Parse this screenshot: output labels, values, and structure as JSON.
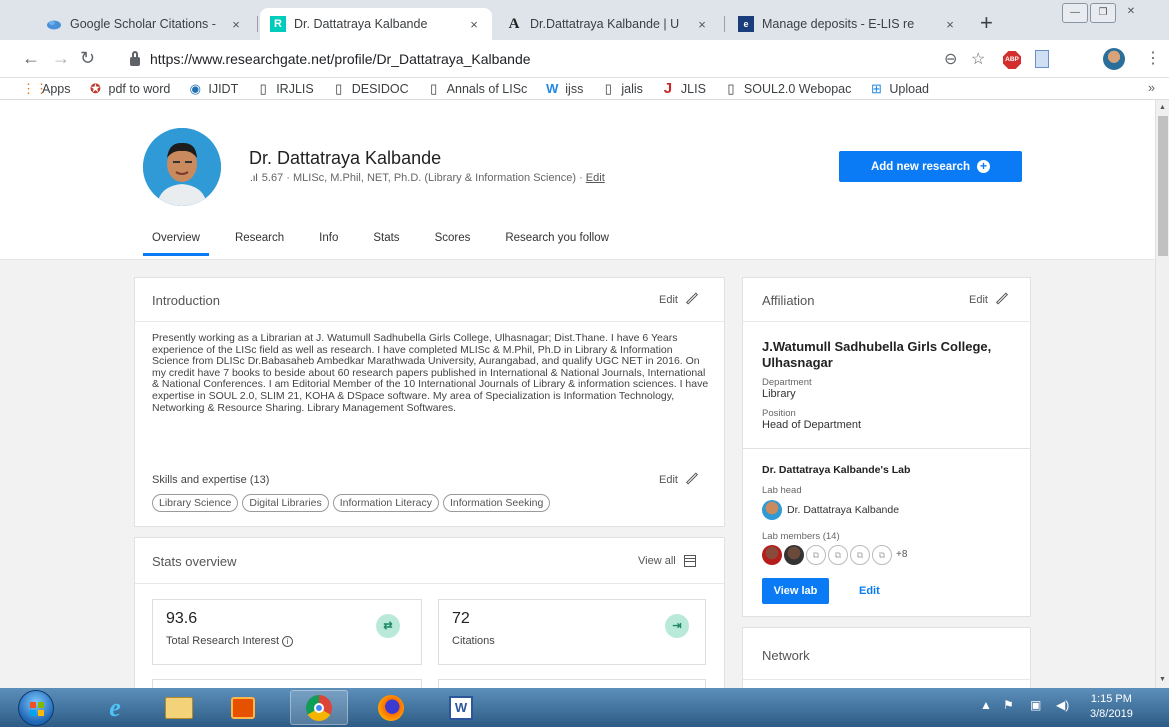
{
  "browser": {
    "tabs": [
      {
        "title": "Google Scholar Citations - ",
        "favicon": "google-scholar-icon",
        "active": false
      },
      {
        "title": "Dr. Dattatraya Kalbande",
        "favicon": "researchgate-icon",
        "active": true
      },
      {
        "title": "Dr.Dattatraya Kalbande | U",
        "favicon": "academia-icon",
        "active": false
      },
      {
        "title": "Manage deposits - E-LIS re",
        "favicon": "elis-icon",
        "active": false
      }
    ],
    "favicon_text": {
      "researchgate": "R",
      "academia": "A",
      "elis": "e"
    },
    "close_glyph": "×",
    "newtab_glyph": "+",
    "url": "https://www.researchgate.net/profile/Dr_Dattatraya_Kalbande",
    "bookmarks": [
      {
        "label": "Apps",
        "icon": "apps-grid-icon"
      },
      {
        "label": "pdf to word",
        "icon": "pdf-icon"
      },
      {
        "label": "IJIDT",
        "icon": "globe-icon"
      },
      {
        "label": "IRJLIS",
        "icon": "page-icon"
      },
      {
        "label": "DESIDOC",
        "icon": "page-icon"
      },
      {
        "label": "Annals of LISc",
        "icon": "page-icon"
      },
      {
        "label": "ijss",
        "icon": "wix-icon"
      },
      {
        "label": "jalis",
        "icon": "page-icon"
      },
      {
        "label": "JLIS",
        "icon": "j-icon"
      },
      {
        "label": "SOUL2.0 Webopac",
        "icon": "page-icon"
      },
      {
        "label": "Upload",
        "icon": "upload-icon"
      }
    ],
    "bookmarks_more": "»"
  },
  "profile": {
    "name": "Dr. Dattatraya Kalbande",
    "rg_score": "5.67",
    "degrees": " · MLISc, M.Phil, NET, Ph.D. (Library & Information Science) · ",
    "edit_link": "Edit",
    "add_button": "Add new research",
    "tabs": [
      "Overview",
      "Research",
      "Info",
      "Stats",
      "Scores",
      "Research you follow"
    ]
  },
  "introduction": {
    "title": "Introduction",
    "edit": "Edit",
    "text": "Presently working as a Librarian at J. Watumull Sadhubella Girls College, Ulhasnagar; Dist.Thane. I have 6 Years experience of the LISc field as well as research. I have completed MLISc & M.Phil, Ph.D in Library & Information Science from DLISc Dr.Babasaheb Ambedkar Marathwada University, Aurangabad, and qualify UGC NET in 2016. On my credit have 7 books to beside about 60 research papers published in International & National Journals, International & National Conferences. I am Editorial Member of the 10 International Journals of Library & information sciences. I have expertise in SOUL 2.0, SLIM 21, KOHA & DSpace software. My area of Specialization is Information Technology, Networking & Resource Sharing. Library Management Softwares.",
    "skills_title": "Skills and expertise (13)",
    "skills": [
      "Library Science",
      "Digital Libraries",
      "Information Literacy",
      "Information Seeking"
    ]
  },
  "stats": {
    "title": "Stats overview",
    "view_all": "View all",
    "items": [
      {
        "value": "93.6",
        "label": "Total Research Interest"
      },
      {
        "value": "72",
        "label": "Citations"
      }
    ]
  },
  "affiliation": {
    "title": "Affiliation",
    "edit": "Edit",
    "org": "J.Watumull Sadhubella Girls College, Ulhasnagar",
    "department_label": "Department",
    "department": "Library",
    "position_label": "Position",
    "position": "Head of Department",
    "lab_title": "Dr. Dattatraya Kalbande's Lab",
    "lab_head_label": "Lab head",
    "lab_head": "Dr. Dattatraya Kalbande",
    "lab_members_label": "Lab members (14)",
    "more_members": "+8",
    "view_lab": "View lab",
    "lab_edit": "Edit"
  },
  "network": {
    "title": "Network"
  },
  "taskbar": {
    "time": "1:15 PM",
    "date": "3/8/2019",
    "apps": [
      "internet-explorer",
      "file-explorer",
      "media-player",
      "chrome",
      "firefox",
      "word"
    ]
  },
  "colors": {
    "accent": "#0a7bf5",
    "stat_icon": "#b9ead9"
  }
}
